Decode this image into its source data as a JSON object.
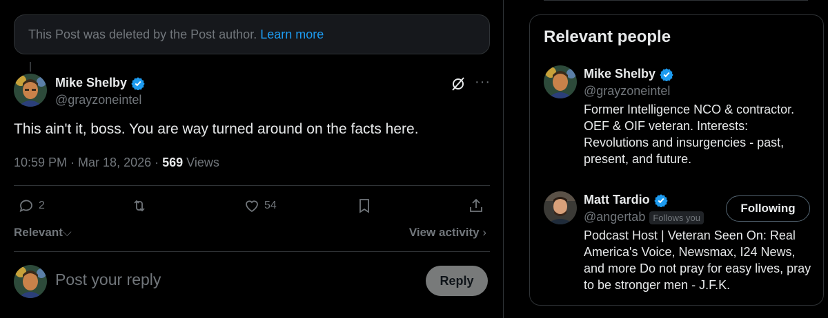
{
  "deleted_notice": {
    "text": "This Post was deleted by the Post author.",
    "link": "Learn more"
  },
  "post": {
    "author_name": "Mike Shelby",
    "author_handle": "@grayzoneintel",
    "text": "This ain't it, boss. You are way turned around on the facts here.",
    "timestamp": "10:59 PM · Mar 18, 2026 · ",
    "views_count": "569",
    "views_label": "Views",
    "replies": "2",
    "likes": "54"
  },
  "sort": {
    "label": "Relevant",
    "view_activity": "View activity"
  },
  "reply": {
    "placeholder": "Post your reply",
    "button": "Reply"
  },
  "sidebar": {
    "title": "Relevant people",
    "people": [
      {
        "name": "Mike Shelby",
        "handle": "@grayzoneintel",
        "bio": "Former Intelligence NCO & contractor. OEF & OIF veteran. Interests: Revolutions and insurgencies - past, present, and future."
      },
      {
        "name": "Matt Tardio",
        "handle": "@angertab",
        "follows_you": "Follows you",
        "button": "Following",
        "bio": "Podcast Host | Veteran Seen On: Real America's Voice, Newsmax, I24 News, and more Do not pray for easy lives, pray to be stronger men - J.F.K."
      }
    ]
  },
  "colors": {
    "accent": "#1d9bf0",
    "muted": "#71767b",
    "text": "#e7e9ea",
    "border": "#2f3336"
  }
}
